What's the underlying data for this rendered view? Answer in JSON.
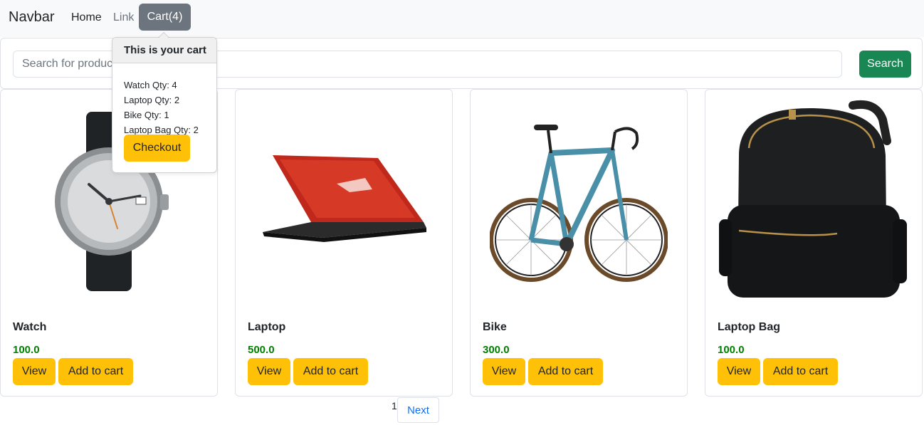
{
  "navbar": {
    "brand": "Navbar",
    "home": "Home",
    "link": "Link",
    "cart": "Cart(4)"
  },
  "search": {
    "placeholder": "Search for products",
    "button": "Search"
  },
  "popover": {
    "title": "This is your cart",
    "items": [
      "Watch Qty: 4",
      "Laptop Qty: 2",
      "Bike Qty: 1",
      "Laptop Bag Qty: 2"
    ],
    "checkout": "Checkout"
  },
  "products": [
    {
      "name": "Watch",
      "price": "100.0",
      "view": "View",
      "add": "Add to cart",
      "image_icon": "watch-image"
    },
    {
      "name": "Laptop",
      "price": "500.0",
      "view": "View",
      "add": "Add to cart",
      "image_icon": "laptop-image"
    },
    {
      "name": "Bike",
      "price": "300.0",
      "view": "View",
      "add": "Add to cart",
      "image_icon": "bike-image"
    },
    {
      "name": "Laptop Bag",
      "price": "100.0",
      "view": "View",
      "add": "Add to cart",
      "image_icon": "bag-image"
    }
  ],
  "pagination": {
    "current": "1",
    "next": "Next"
  },
  "colors": {
    "primary": "#0d6efd",
    "success": "#198754",
    "warning": "#ffc107",
    "secondary": "#6c757d",
    "price": "#008000"
  }
}
